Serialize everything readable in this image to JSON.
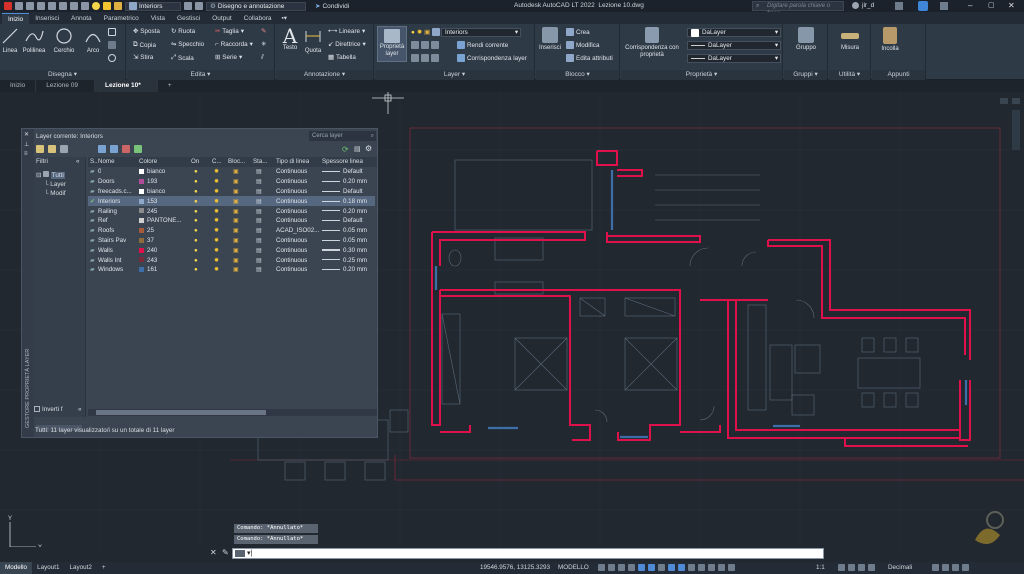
{
  "title_bar": {
    "layer_selector": "Interiors",
    "workspace": "Disegno e annotazione",
    "share": "Condividi",
    "app_title": "Autodesk AutoCAD LT 2022",
    "file_title": "Lezione 10.dwg",
    "search_placeholder": "Digitare parola chiave o frase",
    "user": "jlr_d"
  },
  "ribbon_tabs": [
    "Inizio",
    "Inserisci",
    "Annota",
    "Parametrico",
    "Vista",
    "Gestisci",
    "Output",
    "Collabora"
  ],
  "ribbon": {
    "disegna": {
      "label": "Disegna",
      "linea": "Linea",
      "polilinea": "Polilinea",
      "cerchio": "Cerchio",
      "arco": "Arco"
    },
    "edita": {
      "label": "Edita",
      "sposta": "Sposta",
      "ruota": "Ruota",
      "taglia": "Taglia",
      "copia": "Copia",
      "specchio": "Specchio",
      "raccorda": "Raccorda",
      "stira": "Stira",
      "scala": "Scala",
      "serie": "Serie"
    },
    "annotazione": {
      "label": "Annotazione",
      "testo": "Testo",
      "quota": "Quota",
      "lineare": "Lineare",
      "direttrice": "Direttrice",
      "tabella": "Tabella"
    },
    "layer": {
      "label": "Layer",
      "proprieta": "Proprietà layer",
      "current": "Interiors",
      "rendi_corrente": "Rendi corrente",
      "corrispondenza": "Corrispondenza layer"
    },
    "blocco": {
      "label": "Blocco",
      "inserisci": "Inserisci",
      "crea": "Crea",
      "modifica": "Modifica",
      "edita_attributi": "Edita attributi"
    },
    "proprieta": {
      "label": "Proprietà",
      "corrispondenza": "Corrispondenza con proprietà",
      "color": "DaLayer",
      "linetype": "DaLayer",
      "lineweight": "DaLayer"
    },
    "gruppi": {
      "label": "Gruppi",
      "gruppo": "Gruppo"
    },
    "utilita": {
      "label": "Utilità",
      "misura": "Misura"
    },
    "appunti": {
      "label": "Appunti",
      "incolla": "Incolla"
    }
  },
  "doc_tabs": [
    "Inizio",
    "Lezione 09",
    "Lezione 10*"
  ],
  "layer_panel": {
    "current": "Layer corrente: Interiors",
    "search_placeholder": "Cerca layer",
    "filters_label": "Filtri",
    "tree": [
      "Tutti",
      "Layer",
      "Modif"
    ],
    "invert_label": "Inverti f",
    "side_title": "GESTORE PROPRIETÀ LAYER",
    "headers": {
      "s": "S..",
      "name": "Nome",
      "color": "Colore",
      "on": "On",
      "freeze": "C...",
      "lock": "Bloc...",
      "state": "Sta...",
      "linetype": "Tipo di linea",
      "lineweight": "Spessore linea"
    },
    "rows": [
      {
        "name": "0",
        "color": "bianco",
        "hex": "#ffffff",
        "linetype": "Continuous",
        "lw": "Default"
      },
      {
        "name": "Doors",
        "color": "193",
        "hex": "#b24c9a",
        "linetype": "Continuous",
        "lw": "0.20 mm"
      },
      {
        "name": "freecads.c...",
        "color": "bianco",
        "hex": "#ffffff",
        "linetype": "Continuous",
        "lw": "Default"
      },
      {
        "name": "Interiors",
        "color": "153",
        "hex": "#8fa7c8",
        "linetype": "Continuous",
        "lw": "0.18 mm"
      },
      {
        "name": "Railing",
        "color": "245",
        "hex": "#8a8a8a",
        "linetype": "Continuous",
        "lw": "0.20 mm"
      },
      {
        "name": "Ref",
        "color": "PANTONE...",
        "hex": "#d0d0d0",
        "linetype": "Continuous",
        "lw": "Default"
      },
      {
        "name": "Roofs",
        "color": "25",
        "hex": "#a55b3a",
        "linetype": "ACAD_ISO02...",
        "lw": "0.05 mm"
      },
      {
        "name": "Stairs Pav",
        "color": "37",
        "hex": "#8c6b3e",
        "linetype": "Continuous",
        "lw": "0.05 mm"
      },
      {
        "name": "Walls",
        "color": "240",
        "hex": "#e0104a",
        "linetype": "Continuous",
        "lw": "0.30 mm"
      },
      {
        "name": "Walls Int",
        "color": "243",
        "hex": "#7b2a3a",
        "linetype": "Continuous",
        "lw": "0.25 mm"
      },
      {
        "name": "Windows",
        "color": "161",
        "hex": "#3e6ea8",
        "linetype": "Continuous",
        "lw": "0.20 mm"
      }
    ],
    "status": "Tutti: 11 layer visualizzato/i su un totale di 11 layer"
  },
  "command": {
    "history": [
      "Comando: *Annullato*",
      "Comando: *Annullato*"
    ]
  },
  "status_bar": {
    "tabs": [
      "Modello",
      "Layout1",
      "Layout2"
    ],
    "coords": "19546.9576, 13125.3293",
    "space": "MODELLO",
    "units": "Decimali",
    "scale": "1:1"
  },
  "colors": {
    "walls": "#e0104a",
    "accent": "#4f8ad6",
    "bg": "#212830"
  }
}
